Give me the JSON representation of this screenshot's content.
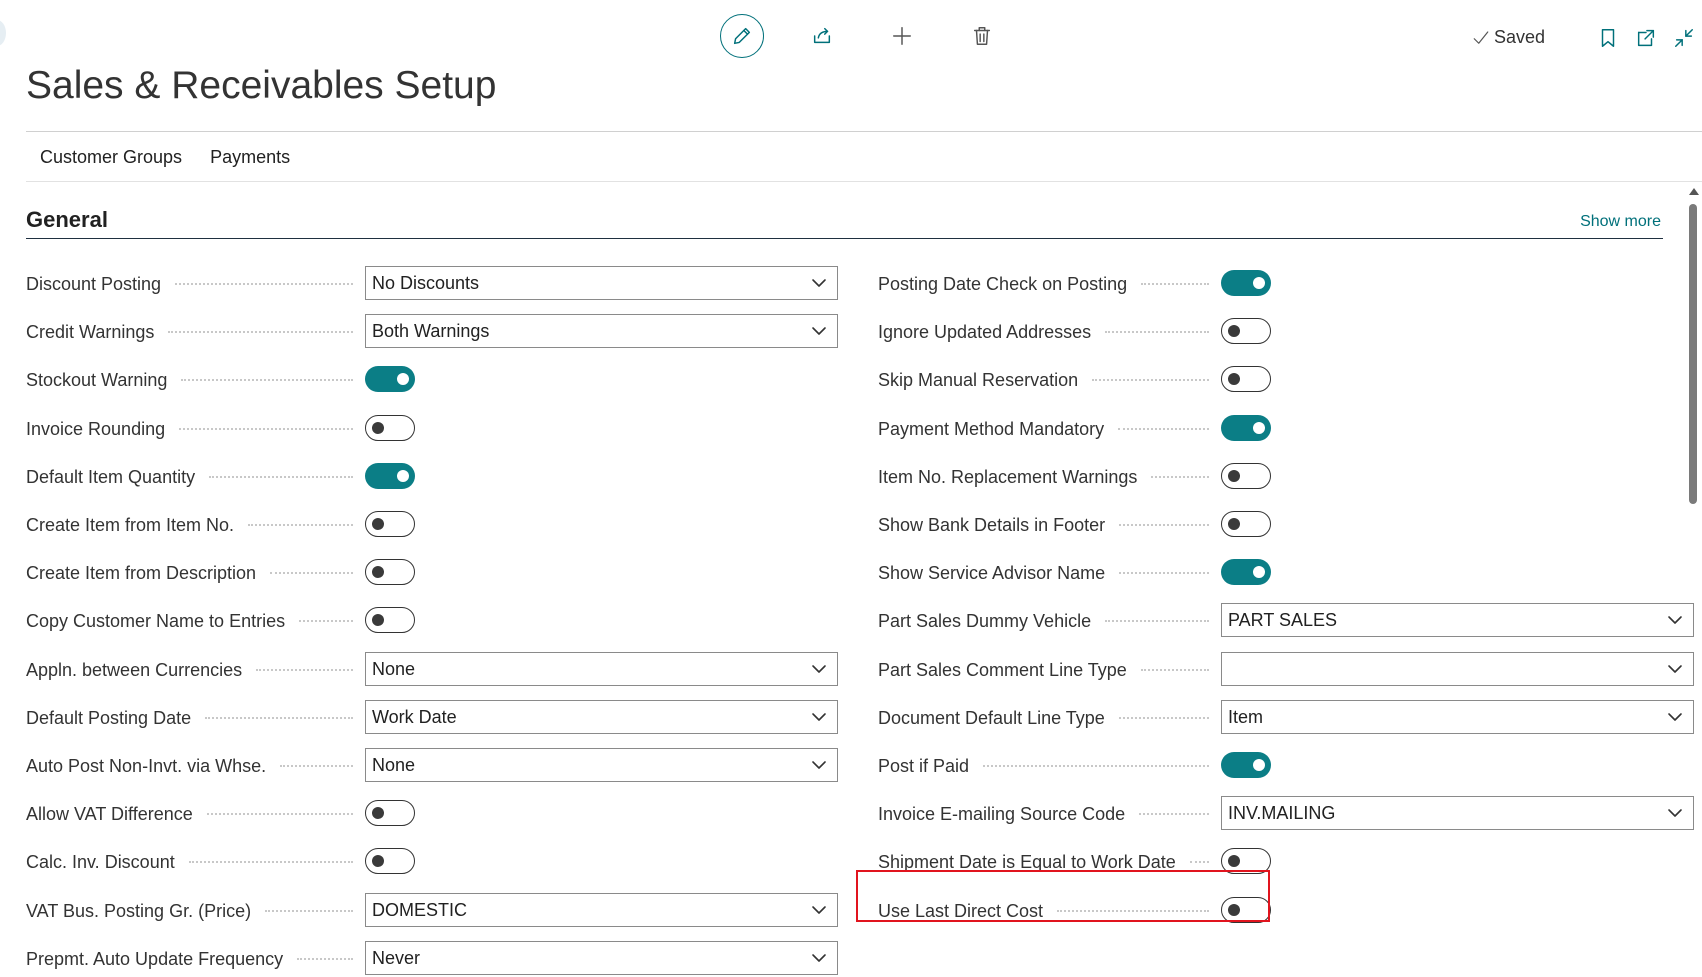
{
  "page": {
    "title": "Sales & Receivables Setup"
  },
  "status": {
    "saved_label": "Saved"
  },
  "actions": [
    {
      "name": "edit-button",
      "icon": "pencil-icon"
    },
    {
      "name": "share-button",
      "icon": "share-icon"
    },
    {
      "name": "new-button",
      "icon": "plus-icon"
    },
    {
      "name": "delete-button",
      "icon": "trash-icon"
    }
  ],
  "window_icons": [
    "bookmark-icon",
    "open-new-window-icon",
    "collapse-icon"
  ],
  "tabs": [
    {
      "label": "Customer Groups"
    },
    {
      "label": "Payments"
    }
  ],
  "section": {
    "title": "General",
    "show_more": "Show more"
  },
  "left_fields": [
    {
      "label": "Discount Posting",
      "type": "dropdown",
      "value": "No Discounts"
    },
    {
      "label": "Credit Warnings",
      "type": "dropdown",
      "value": "Both Warnings"
    },
    {
      "label": "Stockout Warning",
      "type": "toggle",
      "on": true
    },
    {
      "label": "Invoice Rounding",
      "type": "toggle",
      "on": false
    },
    {
      "label": "Default Item Quantity",
      "type": "toggle",
      "on": true
    },
    {
      "label": "Create Item from Item No.",
      "type": "toggle",
      "on": false
    },
    {
      "label": "Create Item from Description",
      "type": "toggle",
      "on": false
    },
    {
      "label": "Copy Customer Name to Entries",
      "type": "toggle",
      "on": false
    },
    {
      "label": "Appln. between Currencies",
      "type": "dropdown",
      "value": "None"
    },
    {
      "label": "Default Posting Date",
      "type": "dropdown",
      "value": "Work Date"
    },
    {
      "label": "Auto Post Non-Invt. via Whse.",
      "type": "dropdown",
      "value": "None"
    },
    {
      "label": "Allow VAT Difference",
      "type": "toggle",
      "on": false
    },
    {
      "label": "Calc. Inv. Discount",
      "type": "toggle",
      "on": false
    },
    {
      "label": "VAT Bus. Posting Gr. (Price)",
      "type": "dropdown",
      "value": "DOMESTIC"
    },
    {
      "label": "Prepmt. Auto Update Frequency",
      "type": "dropdown",
      "value": "Never"
    }
  ],
  "right_fields": [
    {
      "label": "Posting Date Check on Posting",
      "type": "toggle",
      "on": true
    },
    {
      "label": "Ignore Updated Addresses",
      "type": "toggle",
      "on": false
    },
    {
      "label": "Skip Manual Reservation",
      "type": "toggle",
      "on": false
    },
    {
      "label": "Payment Method Mandatory",
      "type": "toggle",
      "on": true
    },
    {
      "label": "Item No. Replacement Warnings",
      "type": "toggle",
      "on": false
    },
    {
      "label": "Show Bank Details in Footer",
      "type": "toggle",
      "on": false
    },
    {
      "label": "Show Service Advisor Name",
      "type": "toggle",
      "on": true
    },
    {
      "label": "Part Sales Dummy Vehicle",
      "type": "dropdown",
      "value": "PART SALES"
    },
    {
      "label": "Part Sales Comment Line Type",
      "type": "dropdown",
      "value": ""
    },
    {
      "label": "Document Default Line Type",
      "type": "dropdown",
      "value": "Item"
    },
    {
      "label": "Post if Paid",
      "type": "toggle",
      "on": true
    },
    {
      "label": "Invoice E-mailing Source Code",
      "type": "dropdown",
      "value": "INV.MAILING"
    },
    {
      "label": "Shipment Date is Equal to Work Date",
      "type": "toggle",
      "on": false
    },
    {
      "label": "Use Last Direct Cost",
      "type": "toggle",
      "on": false,
      "highlighted": true
    }
  ],
  "colors": {
    "accent": "#0b7e86",
    "highlight": "#e1141e",
    "text": "#212121"
  }
}
